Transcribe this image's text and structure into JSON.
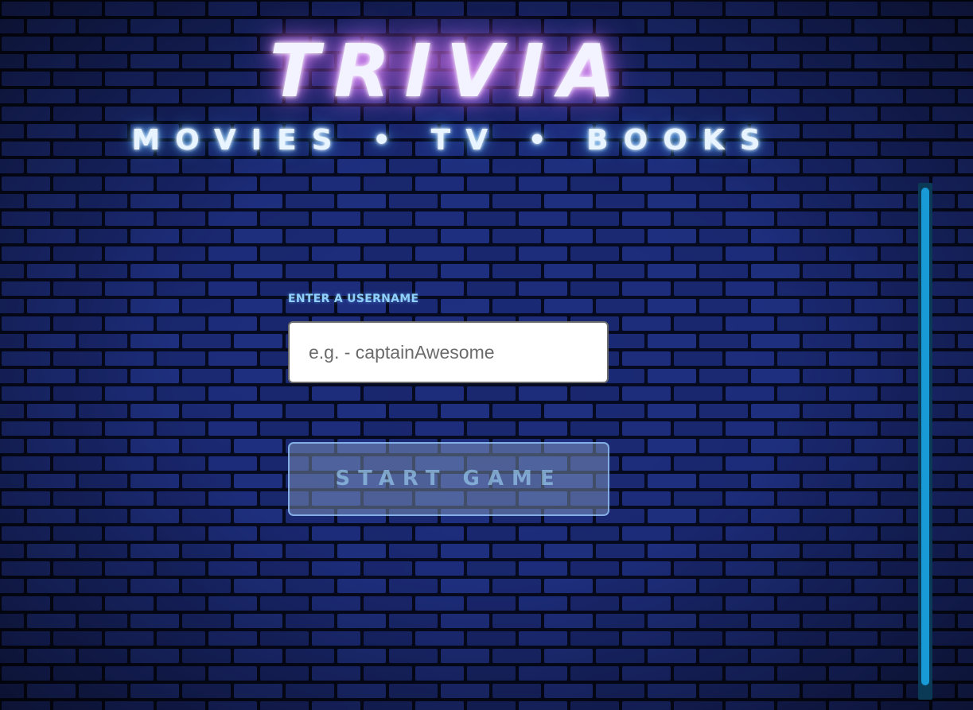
{
  "app": {
    "title": "TRIVIA",
    "subtitle": "MOVIES • TV • BOOKS"
  },
  "form": {
    "username_label": "ENTER A USERNAME",
    "username_placeholder": "e.g. - captainAwesome",
    "username_value": "",
    "start_button_label": "START GAME",
    "start_button_disabled": true
  },
  "colors": {
    "title_glow": "#c06be0",
    "subtitle_glow": "#3f8fe0",
    "label": "#8fd0ff",
    "scrollbar_track": "#0a3a55",
    "scrollbar_thumb": "#179ad6"
  }
}
